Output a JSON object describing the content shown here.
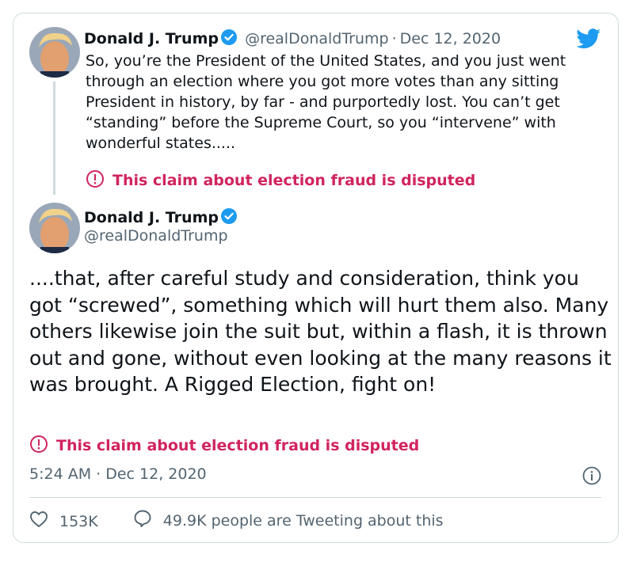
{
  "tweet1": {
    "author_name": "Donald J. Trump",
    "handle": "@realDonaldTrump",
    "separator": "·",
    "date": "Dec 12, 2020",
    "text": "So, you’re the President of the United States, and you just went through an election where you got more votes than any sitting President in history, by far - and purportedly lost. You can’t get “standing” before the Supreme Court, so you “intervene” with wonderful states.....",
    "label": "This claim about election fraud is disputed"
  },
  "tweet2": {
    "author_name": "Donald J. Trump",
    "handle": "@realDonaldTrump",
    "text": "....that, after careful study and consideration, think you got “screwed”, something which will hurt them also. Many others likewise join the suit but, within a flash, it is thrown out and gone, without even looking at the many reasons it was brought. A Rigged Election, fight on!",
    "label": "This claim about election fraud is disputed",
    "timestamp": "5:24 AM · Dec 12, 2020"
  },
  "stats": {
    "likes": "153K",
    "tweeting": "49.9K people are Tweeting about this"
  },
  "icons": {
    "brand": "twitter-bird-icon",
    "verified": "verified-badge-icon",
    "warning": "exclamation-circle-icon",
    "info": "info-icon",
    "like": "heart-icon",
    "reply": "speech-bubble-icon"
  },
  "colors": {
    "twitter_blue": "#1d9bf0",
    "dispute_red": "#d0245e",
    "secondary_text": "#536471",
    "border": "#cfd9de"
  }
}
